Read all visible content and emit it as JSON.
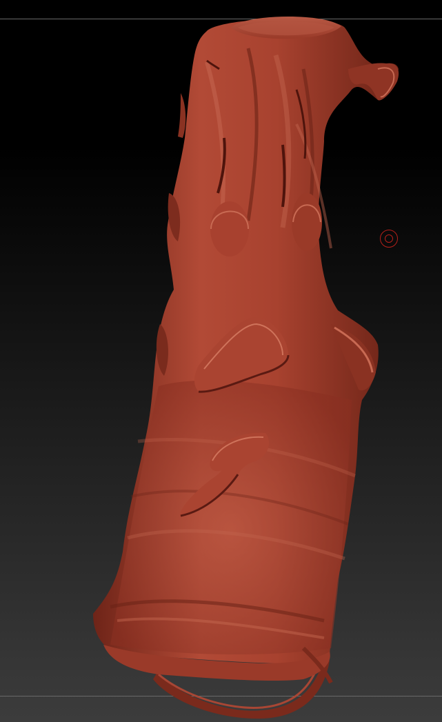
{
  "viewport": {
    "background_top": "#000000",
    "background_bottom": "#3c3c3c",
    "guide_line_color": "#6a6a6a"
  },
  "model": {
    "material_color": "#a6402e",
    "highlight_color": "#c8654f",
    "shadow_color": "#5a1a12",
    "description_icon": "sculpt-mesh-icon"
  },
  "brush_cursor": {
    "icon": "brush-cursor-icon",
    "color": "#b5201a"
  }
}
